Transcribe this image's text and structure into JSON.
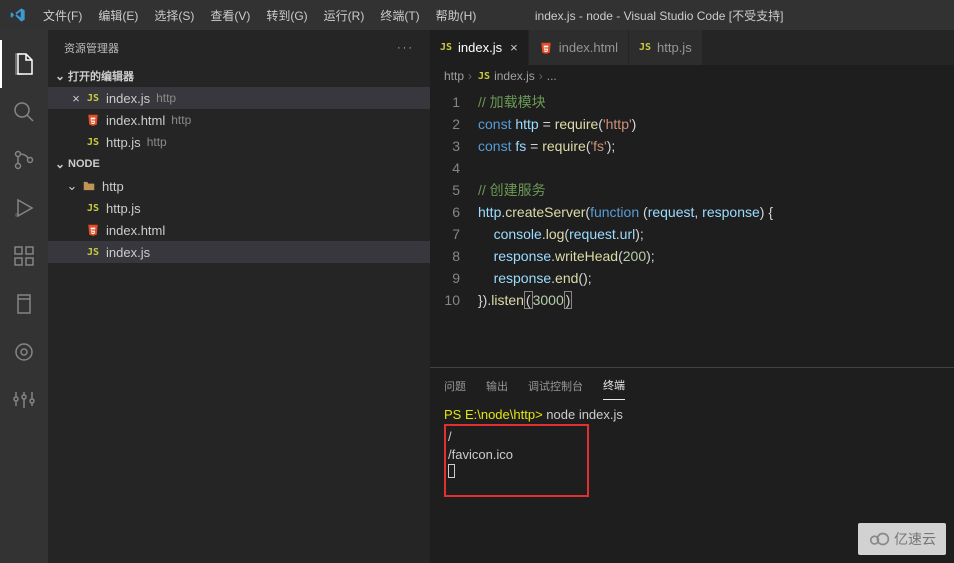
{
  "titlebar": {
    "menus": [
      "文件(F)",
      "编辑(E)",
      "选择(S)",
      "查看(V)",
      "转到(G)",
      "运行(R)",
      "终端(T)",
      "帮助(H)"
    ],
    "title": "index.js - node - Visual Studio Code [不受支持]"
  },
  "sidebar": {
    "title": "资源管理器",
    "sections": {
      "open_editors": {
        "label": "打开的编辑器"
      },
      "folder": {
        "label": "NODE"
      }
    },
    "open_editors": [
      {
        "name": "index.js",
        "dir": "http",
        "type": "js",
        "active": true
      },
      {
        "name": "index.html",
        "dir": "http",
        "type": "html",
        "active": false
      },
      {
        "name": "http.js",
        "dir": "http",
        "type": "js",
        "active": false
      }
    ],
    "tree": {
      "folder": "http",
      "files": [
        {
          "name": "http.js",
          "type": "js"
        },
        {
          "name": "index.html",
          "type": "html"
        },
        {
          "name": "index.js",
          "type": "js",
          "active": true
        }
      ]
    }
  },
  "editor": {
    "tabs": [
      {
        "name": "index.js",
        "type": "js",
        "active": true,
        "close": true
      },
      {
        "name": "index.html",
        "type": "html",
        "active": false,
        "close": false
      },
      {
        "name": "http.js",
        "type": "js",
        "active": false,
        "close": false
      }
    ],
    "breadcrumb": {
      "segments": [
        "http",
        "index.js",
        "..."
      ],
      "icon_after_first": "js"
    },
    "code_lines": [
      {
        "n": 1,
        "html": "<span class='c-comment'>// 加载模块</span>"
      },
      {
        "n": 2,
        "html": "<span class='c-const'>const</span> <span class='c-var'>http</span> <span class='c-paren'>=</span> <span class='c-func'>require</span><span class='c-paren'>(</span><span class='c-str'>'http'</span><span class='c-paren'>)</span>"
      },
      {
        "n": 3,
        "html": "<span class='c-const'>const</span> <span class='c-var'>fs</span> <span class='c-paren'>=</span> <span class='c-func'>require</span><span class='c-paren'>(</span><span class='c-str'>'fs'</span><span class='c-paren'>);</span>"
      },
      {
        "n": 4,
        "html": ""
      },
      {
        "n": 5,
        "html": "<span class='c-comment'>// 创建服务</span>"
      },
      {
        "n": 6,
        "html": "<span class='c-var'>http</span><span class='c-paren'>.</span><span class='c-func'>createServer</span><span class='c-paren'>(</span><span class='c-const'>function</span> <span class='c-paren'>(</span><span class='c-var'>request</span><span class='c-paren'>,</span> <span class='c-var'>response</span><span class='c-paren'>) {</span>"
      },
      {
        "n": 7,
        "html": "    <span class='c-var'>console</span><span class='c-paren'>.</span><span class='c-func'>log</span><span class='c-paren'>(</span><span class='c-var'>request</span><span class='c-paren'>.</span><span class='c-var'>url</span><span class='c-paren'>);</span>"
      },
      {
        "n": 8,
        "html": "    <span class='c-var'>response</span><span class='c-paren'>.</span><span class='c-func'>writeHead</span><span class='c-paren'>(</span><span class='c-num'>200</span><span class='c-paren'>);</span>"
      },
      {
        "n": 9,
        "html": "    <span class='c-var'>response</span><span class='c-paren'>.</span><span class='c-func'>end</span><span class='c-paren'>();</span>"
      },
      {
        "n": 10,
        "html": "<span class='c-paren'>}).</span><span class='c-func'>listen</span><span class='c-hlparen c-paren'>(</span><span class='c-num'>3000</span><span class='c-hlparen c-paren'>)</span>"
      }
    ]
  },
  "panel": {
    "tabs": {
      "problems": "问题",
      "output": "输出",
      "debug": "调试控制台",
      "terminal": "终端"
    },
    "terminal": {
      "prompt_path": "PS E:\\node\\http>",
      "command": "node index.js",
      "out_lines": [
        "/",
        "/favicon.ico"
      ]
    }
  },
  "watermark": "亿速云"
}
